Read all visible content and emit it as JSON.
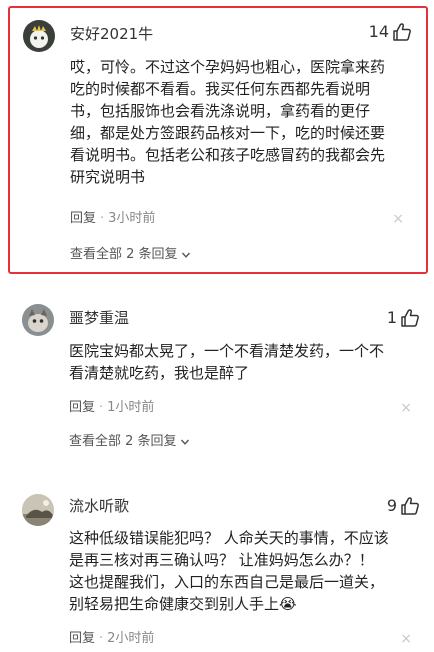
{
  "comments": [
    {
      "username": "安好2021牛",
      "likes": "14",
      "lines": [
        "哎，可怜。不过这个孕妈妈也粗心，医院拿来药",
        "吃的时候都不看看。我买任何东西都先看说明",
        "书，包括服饰也会看洗涤说明，拿药看的更仔",
        "细，都是处方签跟药品核对一下，吃的时候还要",
        "看说明书。包括老公和孩子吃感冒药的我都会先",
        "研究说明书"
      ],
      "reply_label": "回复",
      "dot": "·",
      "time": "3小时前",
      "close": "×",
      "view_all": "查看全部 2 条回复"
    },
    {
      "username": "噩梦重温",
      "likes": "1",
      "lines": [
        "医院宝妈都太晃了，一个不看清楚发药，一个不",
        "看清楚就吃药，我也是醉了"
      ],
      "reply_label": "回复",
      "dot": "·",
      "time": "1小时前",
      "close": "×",
      "view_all": "查看全部 2 条回复"
    },
    {
      "username": "流水听歌",
      "likes": "9",
      "lines": [
        "这种低级错误能犯吗？ 人命关天的事情，不应该",
        "是再三核对再三确认吗？ 让准妈妈怎么办？！",
        "这也提醒我们，入口的东西自己是最后一道关，",
        "别轻易把生命健康交到别人手上😭"
      ],
      "reply_label": "回复",
      "dot": "·",
      "time": "2小时前",
      "close": "×"
    }
  ],
  "colors": {
    "highlight_border": "#e3323c",
    "meta_text": "#888888"
  }
}
